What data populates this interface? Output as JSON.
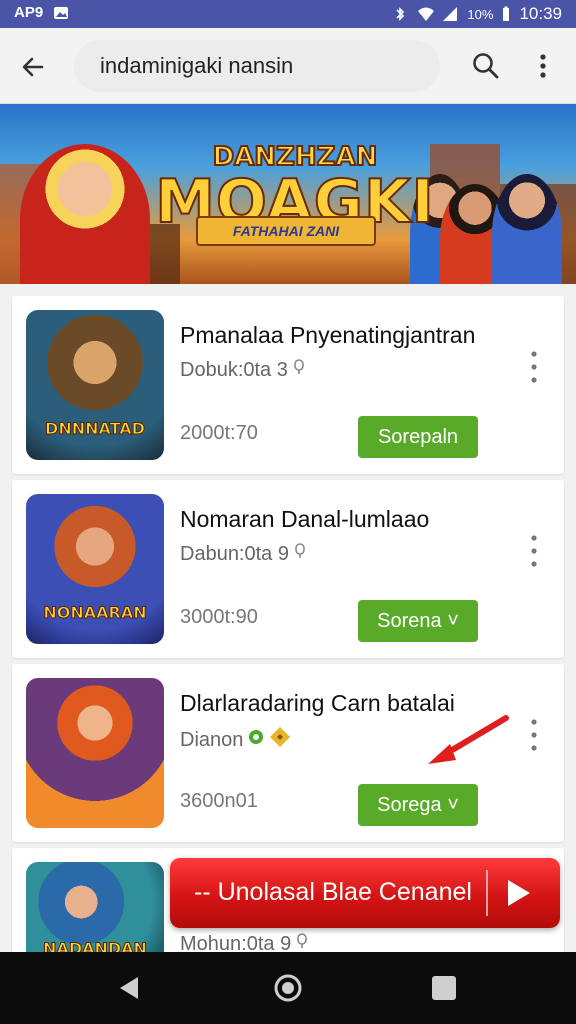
{
  "status_bar": {
    "left_text": "AP9",
    "battery": "10%",
    "time": "10:39"
  },
  "search": {
    "query": "indaminigaki nansin",
    "icons": {
      "back": "back-arrow-icon",
      "search": "search-icon",
      "more": "more-vert-icon"
    }
  },
  "banner": {
    "title_top": "DANZHZAN",
    "title_main": "MOAGKI",
    "ribbon": "FATHAHAI ZANI"
  },
  "apps": [
    {
      "name": "Pmanalaa Pnyenatingjantran",
      "meta": "Dobuk:0ta 3",
      "price": "2000t:70",
      "button": "Sorepaln",
      "thumb_caption": "DNNNATAD",
      "theme": "bronze"
    },
    {
      "name": "Nomaran Danal-lumlaao",
      "meta": "Dabun:0ta 9",
      "price": "3000t:90",
      "button": "Sorena",
      "thumb_caption": "NONAARAN",
      "theme": "blue"
    },
    {
      "name": "Dlarlaradaring Carn batalai",
      "meta": "Dianon",
      "price": "3600n01",
      "button": "Sorega",
      "thumb_caption": "",
      "theme": "orange"
    },
    {
      "name": "",
      "meta": "Mohun:0ta 9",
      "price": "",
      "button": "",
      "thumb_caption": "NADANDAN",
      "theme": "teal"
    }
  ],
  "cta": {
    "label": "-- Unolasal Blae Cenanel",
    "icon": "play-icon"
  },
  "nav": {
    "back": "nav-back-icon",
    "home": "nav-home-icon",
    "recents": "nav-recents-icon"
  },
  "colors": {
    "status": "#4a55a8",
    "install_green": "#5aaa2a",
    "cta_red": "#d41414",
    "arrow_red": "#e11d1d"
  }
}
